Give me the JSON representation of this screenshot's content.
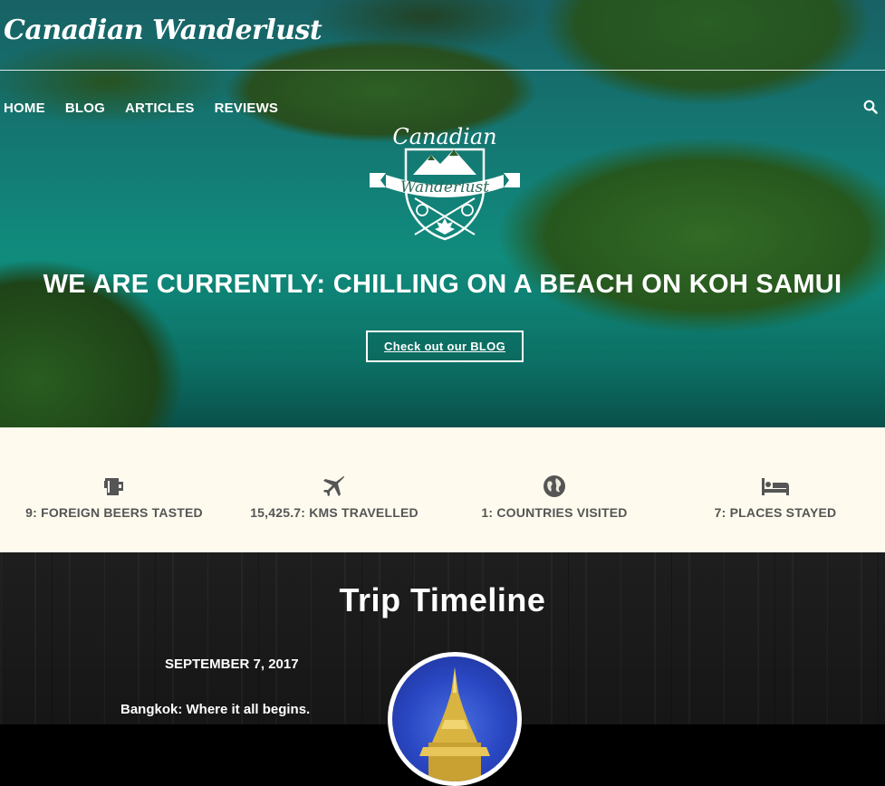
{
  "header": {
    "site_title": "Canadian Wanderlust"
  },
  "nav": {
    "items": [
      {
        "label": "HOME"
      },
      {
        "label": "BLOG"
      },
      {
        "label": "ARTICLES"
      },
      {
        "label": "REVIEWS"
      }
    ],
    "search_icon": "search-icon"
  },
  "hero": {
    "logo_text_top": "Canadian",
    "logo_text_banner": "Wanderlust",
    "headline": "WE ARE CURRENTLY: CHILLING ON A BEACH ON KOH SAMUI",
    "cta_label": "Check out our BLOG"
  },
  "stats": [
    {
      "icon": "beer-mug-icon",
      "label": "9: FOREIGN BEERS TASTED"
    },
    {
      "icon": "airplane-icon",
      "label": "15,425.7: KMS TRAVELLED"
    },
    {
      "icon": "globe-icon",
      "label": "1: COUNTRIES VISITED"
    },
    {
      "icon": "bed-icon",
      "label": "7: PLACES STAYED"
    }
  ],
  "timeline": {
    "title": "Trip Timeline",
    "entries": [
      {
        "date": "SEPTEMBER 7, 2017",
        "title": "Bangkok: Where it all begins."
      }
    ]
  },
  "colors": {
    "stats_bg": "#fefbee",
    "stats_text": "#555555",
    "timeline_bg": "#1a1a1a"
  }
}
